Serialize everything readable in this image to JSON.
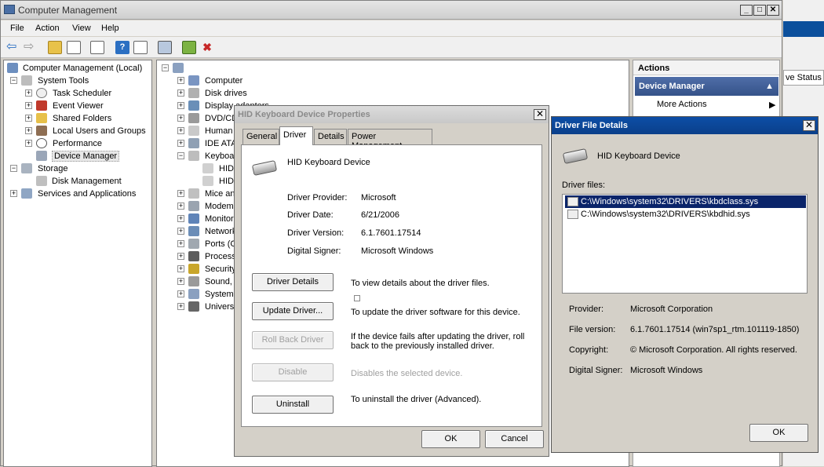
{
  "main_window": {
    "title": "Computer Management",
    "menu": [
      "File",
      "Action",
      "View",
      "Help"
    ]
  },
  "tree": {
    "items": [
      {
        "label": "Computer Management (Local)",
        "icon": "computer-management-icon"
      },
      {
        "label": "System Tools",
        "icon": "tools-icon"
      },
      {
        "label": "Task Scheduler",
        "icon": "clock-icon"
      },
      {
        "label": "Event Viewer",
        "icon": "event-viewer-icon"
      },
      {
        "label": "Shared Folders",
        "icon": "shared-folder-icon"
      },
      {
        "label": "Local Users and Groups",
        "icon": "users-icon"
      },
      {
        "label": "Performance",
        "icon": "performance-icon"
      },
      {
        "label": "Device Manager",
        "icon": "device-manager-icon"
      },
      {
        "label": "Storage",
        "icon": "storage-icon"
      },
      {
        "label": "Disk Management",
        "icon": "disk-icon"
      },
      {
        "label": "Services and Applications",
        "icon": "services-icon"
      }
    ]
  },
  "devices": {
    "items": [
      "Computer",
      "Disk drives",
      "Display adapters",
      "DVD/CD",
      "Human I",
      "IDE ATA",
      "Keyboar",
      "HID",
      "HID",
      "Mice an",
      "Modems",
      "Monitors",
      "Network",
      "Ports (C",
      "Process",
      "Security",
      "Sound,",
      "System",
      "Univers"
    ]
  },
  "actions": {
    "header": "Actions",
    "section": "Device Manager",
    "more": "More Actions"
  },
  "behind": {
    "status": "ve Status"
  },
  "hid_dialog": {
    "title": "HID Keyboard Device Properties",
    "tabs": [
      "General",
      "Driver",
      "Details",
      "Power Management"
    ],
    "device_name": "HID Keyboard Device",
    "fields": [
      {
        "label": "Driver Provider:",
        "value": "Microsoft"
      },
      {
        "label": "Driver Date:",
        "value": "6/21/2006"
      },
      {
        "label": "Driver Version:",
        "value": "6.1.7601.17514"
      },
      {
        "label": "Digital Signer:",
        "value": "Microsoft Windows"
      }
    ],
    "buttons": [
      {
        "label": "Driver Details",
        "desc": "To view details about the driver files."
      },
      {
        "label": "Update Driver...",
        "desc": "To update the driver software for this device."
      },
      {
        "label": "Roll Back Driver",
        "desc": "If the device fails after updating the driver, roll back to the previously installed driver."
      },
      {
        "label": "Disable",
        "desc": "Disables the selected device."
      },
      {
        "label": "Uninstall",
        "desc": "To uninstall the driver (Advanced)."
      }
    ],
    "ok": "OK",
    "cancel": "Cancel"
  },
  "driver_details": {
    "title": "Driver File Details",
    "device_name": "HID Keyboard Device",
    "files_label": "Driver files:",
    "files": [
      "C:\\Windows\\system32\\DRIVERS\\kbdclass.sys",
      "C:\\Windows\\system32\\DRIVERS\\kbdhid.sys"
    ],
    "info": [
      {
        "label": "Provider:",
        "value": "Microsoft Corporation"
      },
      {
        "label": "File version:",
        "value": "6.1.7601.17514 (win7sp1_rtm.101119-1850)"
      },
      {
        "label": "Copyright:",
        "value": "© Microsoft Corporation. All rights reserved."
      },
      {
        "label": "Digital Signer:",
        "value": "Microsoft Windows"
      }
    ],
    "ok": "OK"
  }
}
